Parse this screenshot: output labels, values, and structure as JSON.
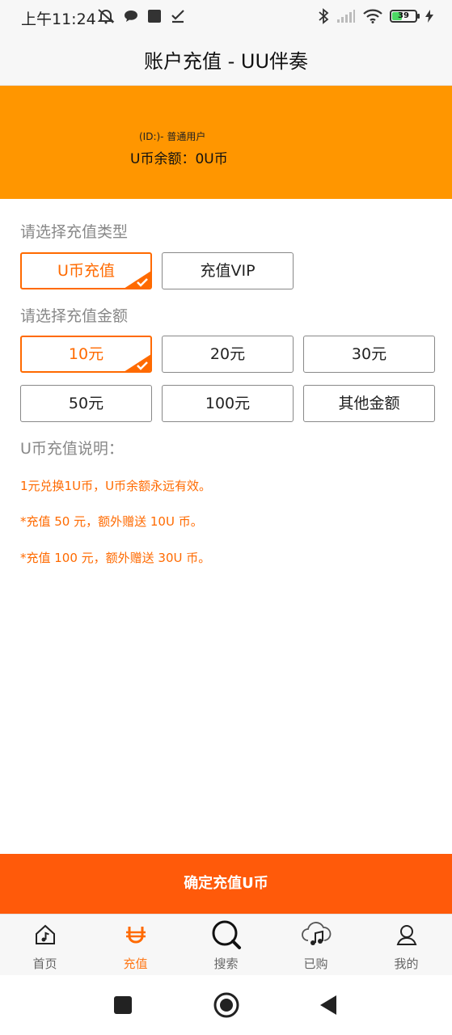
{
  "status_bar": {
    "time": "上午11:24",
    "battery_level": "39",
    "icons": [
      "mute-bell-icon",
      "message-bubble-icon",
      "square-icon",
      "check-icon",
      "bluetooth-icon",
      "signal-icon",
      "wifi-icon",
      "battery-icon",
      "charging-icon"
    ]
  },
  "title_bar": {
    "title": "账户充值 - UU伴奏"
  },
  "banner": {
    "user_line": "(ID:)- 普通用户",
    "balance_line": "U币余额：0U币",
    "background_color": "#ff9600"
  },
  "recharge_type": {
    "label": "请选择充值类型",
    "options": [
      "U币充值",
      "充值VIP"
    ],
    "selected": "U币充值"
  },
  "amount": {
    "label": "请选择充值金额",
    "options": [
      "10元",
      "20元",
      "30元",
      "50元",
      "100元",
      "其他金额"
    ],
    "selected": "10元"
  },
  "notes": {
    "title": "U币充值说明：",
    "lines": [
      "1元兑换1U币，U币余额永远有效。",
      "*充值 50 元，额外赠送 10U 币。",
      "*充值 100 元，额外赠送 30U 币。"
    ]
  },
  "confirm": {
    "label": "确定充值U币",
    "color": "#ff5a0a"
  },
  "tabs": [
    {
      "label": "首页",
      "icon": "home-music-icon"
    },
    {
      "label": "充值",
      "icon": "u-coin-icon",
      "active": true
    },
    {
      "label": "搜索",
      "icon": "search-icon"
    },
    {
      "label": "已购",
      "icon": "cloud-music-icon"
    },
    {
      "label": "我的",
      "icon": "user-icon"
    }
  ],
  "nav_bar": {
    "icons": [
      "recent-apps-icon",
      "home-circle-icon",
      "back-icon"
    ]
  },
  "accent_color": "#ff6a00"
}
